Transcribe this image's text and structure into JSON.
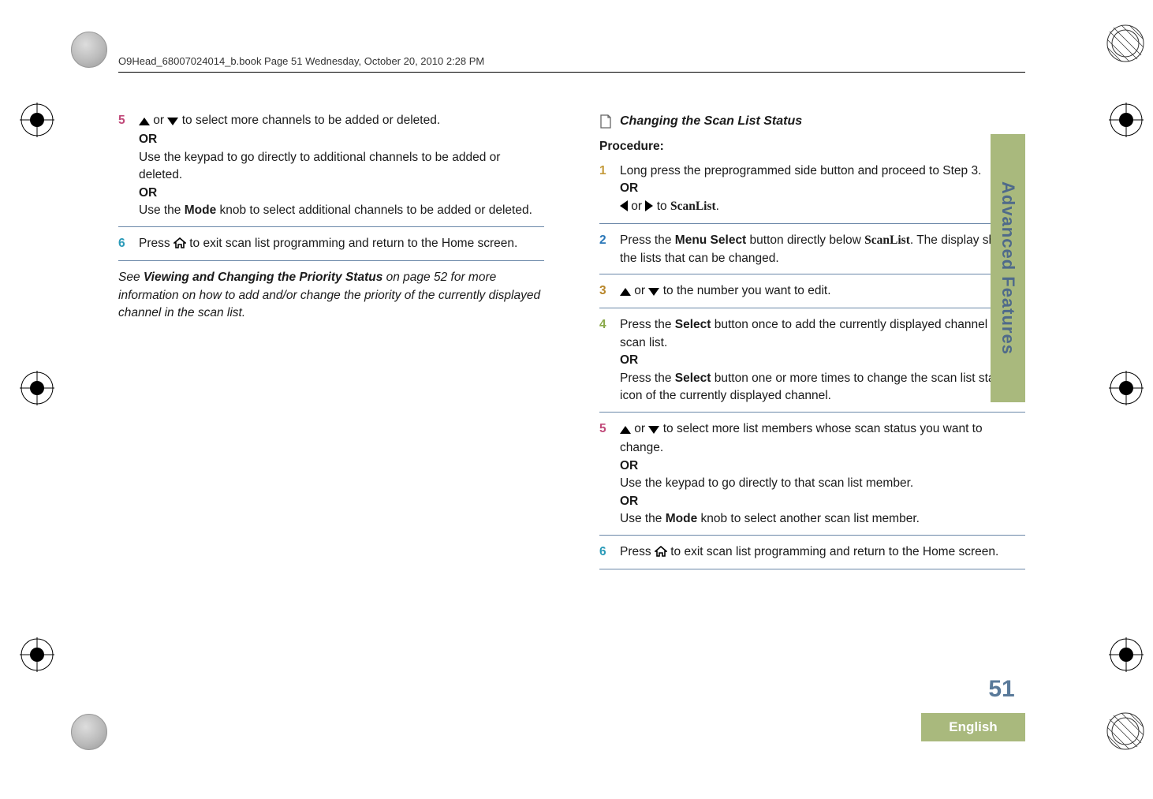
{
  "header": {
    "running_head": "O9Head_68007024014_b.book  Page 51  Wednesday, October 20, 2010  2:28 PM"
  },
  "side_tab": "Advanced Features",
  "page_number": "51",
  "language": "English",
  "left": {
    "step5": {
      "num": "5",
      "line1_prefix": "",
      "line1_mid": " or ",
      "line1_suffix": " to select more channels to be added or deleted.",
      "or1": "OR",
      "line2": "Use the keypad to go directly to additional channels to be added or deleted.",
      "or2": "OR",
      "line3a": "Use the ",
      "mode": "Mode",
      "line3b": " knob to select additional channels to be added or deleted."
    },
    "step6": {
      "num": "6",
      "line1a": "Press ",
      "line1b": " to exit scan list programming and return to the Home screen."
    },
    "note": {
      "a": "See ",
      "bold": "Viewing and Changing the Priority Status",
      "b": " on page 52 for more information on how to add and/or change the priority of the currently displayed channel in the scan list."
    }
  },
  "right": {
    "section_title": "Changing the Scan List Status",
    "procedure_label": "Procedure:",
    "step1": {
      "num": "1",
      "line1": "Long press the preprogrammed side button and proceed to Step 3.",
      "or": "OR",
      "line2_mid": " or ",
      "line2_to": " to ",
      "scanlist": "ScanList",
      "dot": "."
    },
    "step2": {
      "num": "2",
      "a": "Press the ",
      "menu_select": "Menu Select",
      "b": " button directly below ",
      "scanlist": "ScanList",
      "c": ". The display shows the lists that can be changed."
    },
    "step3": {
      "num": "3",
      "mid": " or ",
      "suffix": " to the number you want to edit."
    },
    "step4": {
      "num": "4",
      "a": "Press the ",
      "select": "Select",
      "b": " button once to add the currently displayed channel to the scan list.",
      "or": "OR",
      "c": "Press the ",
      "select2": "Select",
      "d": " button one or more times to change the scan list status icon of the currently displayed channel."
    },
    "step5": {
      "num": "5",
      "mid": " or ",
      "suffix": " to select more list members whose scan status you want to change.",
      "or1": "OR",
      "line2": "Use the keypad to go directly to that scan list member.",
      "or2": "OR",
      "line3a": "Use the ",
      "mode": "Mode",
      "line3b": " knob to select another scan list member."
    },
    "step6": {
      "num": "6",
      "a": "Press ",
      "b": " to exit scan list programming and return to the Home screen."
    }
  }
}
